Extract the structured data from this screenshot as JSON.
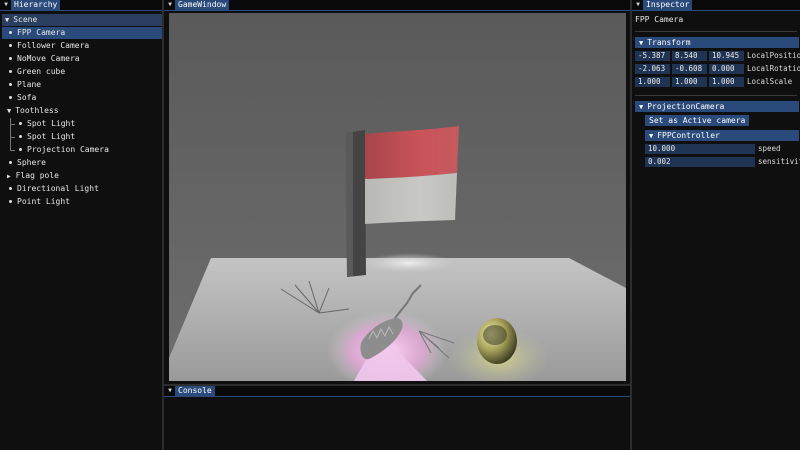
{
  "hierarchy": {
    "tab_label": "Hierarchy",
    "scene_label": "Scene",
    "items": [
      {
        "label": "FPP Camera"
      },
      {
        "label": "Follower Camera"
      },
      {
        "label": "NoMove Camera"
      },
      {
        "label": "Green cube"
      },
      {
        "label": "Plane"
      },
      {
        "label": "Sofa"
      },
      {
        "label": "Toothless"
      },
      {
        "label": "Spot Light"
      },
      {
        "label": "Spot Light"
      },
      {
        "label": "Projection Camera"
      },
      {
        "label": "Sphere"
      },
      {
        "label": "Flag pole"
      },
      {
        "label": "Directional Light"
      },
      {
        "label": "Point Light"
      }
    ]
  },
  "game": {
    "tab_label": "GameWindow"
  },
  "console": {
    "tab_label": "Console"
  },
  "inspector": {
    "tab_label": "Inspector",
    "object_name": "FPP Camera",
    "transform": {
      "header": "Transform",
      "position": {
        "x": "-5.387",
        "y": "8.540",
        "z": "10.945",
        "label": "LocalPosition"
      },
      "rotation": {
        "x": "-2.063",
        "y": "-0.608",
        "z": "0.000",
        "label": "LocalRotationD"
      },
      "scale": {
        "x": "1.000",
        "y": "1.000",
        "z": "1.000",
        "label": "LocalScale"
      }
    },
    "projection": {
      "header": "ProjectionCamera",
      "active_button": "Set as Active camera",
      "controller": {
        "header": "FPPController",
        "speed_value": "10.000",
        "speed_label": "speed",
        "sensitivity_value": "0.002",
        "sensitivity_label": "sensitivity"
      }
    }
  },
  "glyphs": {
    "collapse_arrow": "▼",
    "expand_arrow": "▶",
    "dock_arrow": "▼"
  },
  "colors": {
    "accent": "#294a7a",
    "header": "#2a3f5f",
    "field": "#1f3352",
    "background": "#0f0f0f",
    "viewport": "#5f5f5f"
  }
}
